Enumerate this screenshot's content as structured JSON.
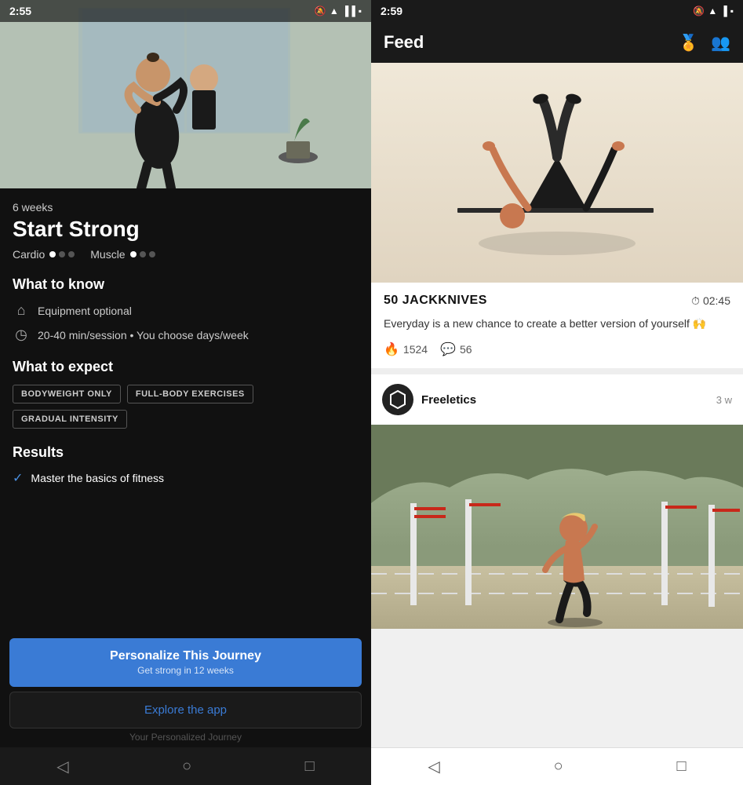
{
  "left": {
    "statusBar": {
      "time": "2:55",
      "icons": [
        "📷",
        "🔔",
        "📶",
        "🔋"
      ]
    },
    "program": {
      "weeks": "6 weeks",
      "title": "Start Strong",
      "intensities": [
        {
          "label": "Cardio",
          "filled": 1,
          "total": 3
        },
        {
          "label": "Muscle",
          "filled": 1,
          "total": 3
        }
      ]
    },
    "whatToKnow": {
      "sectionTitle": "What to know",
      "items": [
        {
          "icon": "🏠",
          "text": "Equipment optional"
        },
        {
          "icon": "⏱",
          "text": "20-40 min/session • You choose days/week"
        }
      ]
    },
    "whatToExpect": {
      "sectionTitle": "What to expect",
      "tags": [
        "BODYWEIGHT ONLY",
        "FULL-BODY EXERCISES",
        "GRADUAL INTENSITY"
      ]
    },
    "results": {
      "sectionTitle": "Results",
      "items": [
        {
          "text": "Master the basics of fitness"
        }
      ]
    },
    "buttons": {
      "primary": {
        "label": "Personalize This Journey",
        "sublabel": "Get strong in 12 weeks"
      },
      "secondary": {
        "label": "Explore the app"
      },
      "hint": "Your Personalized Journey"
    },
    "bottomNav": [
      "◁",
      "○",
      "□"
    ]
  },
  "right": {
    "statusBar": {
      "time": "2:59",
      "icons": [
        "🔔",
        "📶",
        "🔋"
      ]
    },
    "header": {
      "title": "Feed",
      "icons": [
        "medal",
        "people"
      ]
    },
    "workoutCard": {
      "name": "50 JACKKNIVES",
      "time": "02:45",
      "description": "Everyday is a new chance to create a better version of yourself 🙌",
      "stats": [
        {
          "icon": "👊",
          "value": "1524"
        },
        {
          "icon": "💬",
          "value": "56"
        }
      ]
    },
    "post": {
      "username": "Freeletics",
      "timeAgo": "3 w",
      "avatarIcon": "hexagon"
    },
    "bottomNav": [
      "◁",
      "○",
      "□"
    ]
  }
}
